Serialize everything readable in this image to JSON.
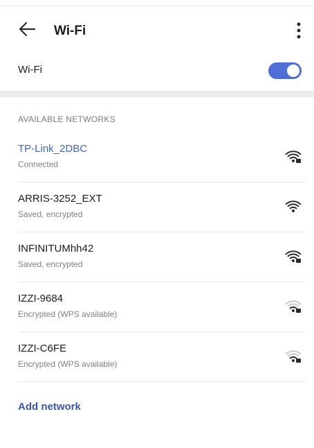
{
  "header": {
    "title": "Wi-Fi",
    "back_icon": "arrow-left-icon",
    "menu_icon": "more-vert-icon"
  },
  "wifi_toggle": {
    "label": "Wi-Fi",
    "on": true,
    "accent_color": "#4f6ed8"
  },
  "available": {
    "header": "AVAILABLE NETWORKS",
    "networks": [
      {
        "name": "TP-Link_2DBC",
        "status": "Connected",
        "connected": true,
        "signal_bars": 4,
        "locked": true
      },
      {
        "name": "ARRIS-3252_EXT",
        "status": "Saved, encrypted",
        "connected": false,
        "signal_bars": 4,
        "locked": false
      },
      {
        "name": "INFINITUMhh42",
        "status": "Saved, encrypted",
        "connected": false,
        "signal_bars": 4,
        "locked": true
      },
      {
        "name": "IZZI-9684",
        "status": "Encrypted (WPS available)",
        "connected": false,
        "signal_bars": 2,
        "locked": true
      },
      {
        "name": "IZZI-C6FE",
        "status": "Encrypted (WPS available)",
        "connected": false,
        "signal_bars": 2,
        "locked": true
      }
    ]
  },
  "add_network": {
    "label": "Add network"
  },
  "colors": {
    "connected_text": "#3f64d4",
    "link_text": "#3a56b8"
  }
}
